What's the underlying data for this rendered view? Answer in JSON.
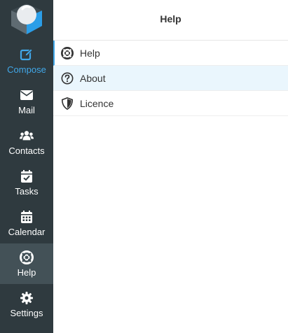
{
  "app": {
    "logo_icon": "roundcube-cube-icon"
  },
  "nav": {
    "items": [
      {
        "label": "Compose",
        "icon": "pencil-square-icon",
        "color": "#41a7e8"
      },
      {
        "label": "Mail",
        "icon": "envelope-icon"
      },
      {
        "label": "Contacts",
        "icon": "users-icon"
      },
      {
        "label": "Tasks",
        "icon": "calendar-check-icon"
      },
      {
        "label": "Calendar",
        "icon": "calendar-icon"
      },
      {
        "label": "Help",
        "icon": "life-ring-icon",
        "active": true
      },
      {
        "label": "Settings",
        "icon": "gear-icon"
      }
    ],
    "background": "#2f3a3f",
    "active_background": "#435157"
  },
  "header": {
    "title": "Help"
  },
  "menu": {
    "items": [
      {
        "label": "Help",
        "icon": "life-ring-icon",
        "selected": true
      },
      {
        "label": "About",
        "icon": "question-circle-icon",
        "hovered": true
      },
      {
        "label": "Licence",
        "icon": "shield-icon"
      }
    ],
    "accent": "#41a7e8",
    "hover_background": "#eaf6fd"
  }
}
